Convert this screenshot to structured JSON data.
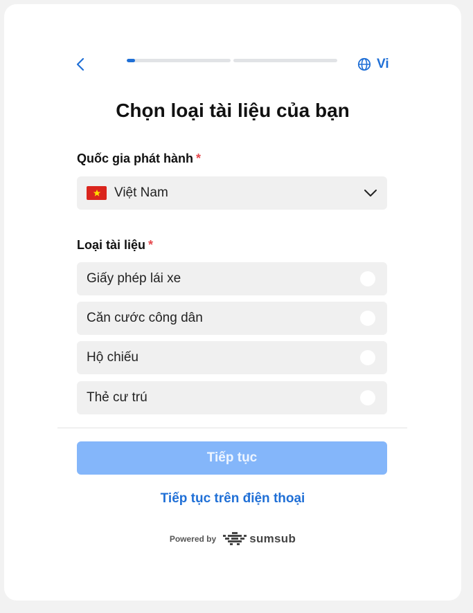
{
  "header": {
    "back_icon": "chevron-left-icon",
    "progress": [
      {
        "step": 1,
        "fill_fraction": 0.08
      },
      {
        "step": 2,
        "fill_fraction": 0.0
      }
    ],
    "language_icon": "globe-icon",
    "language_label": "Vi"
  },
  "title": "Chọn loại tài liệu của bạn",
  "country": {
    "label": "Quốc gia phát hành",
    "required_mark": "*",
    "selected": "Việt Nam",
    "flag_icon": "vietnam-flag-icon",
    "dropdown_icon": "chevron-down-icon"
  },
  "document_type": {
    "label": "Loại tài liệu",
    "required_mark": "*",
    "options": [
      {
        "label": "Giấy phép lái xe",
        "selected": false
      },
      {
        "label": "Căn cước công dân",
        "selected": false
      },
      {
        "label": "Hộ chiếu",
        "selected": false
      },
      {
        "label": "Thẻ cư trú",
        "selected": false
      }
    ]
  },
  "actions": {
    "continue_label": "Tiếp tục",
    "continue_enabled": false,
    "continue_on_phone_label": "Tiếp tục trên điện thoại"
  },
  "footer": {
    "powered_by": "Powered by",
    "brand_name": "sumsub",
    "brand_icon": "sumsub-logo-icon"
  },
  "colors": {
    "accent": "#1f6fd6",
    "disabled_button": "#84b6fa",
    "required": "#e5484d",
    "field_bg": "#f0f0f0"
  }
}
